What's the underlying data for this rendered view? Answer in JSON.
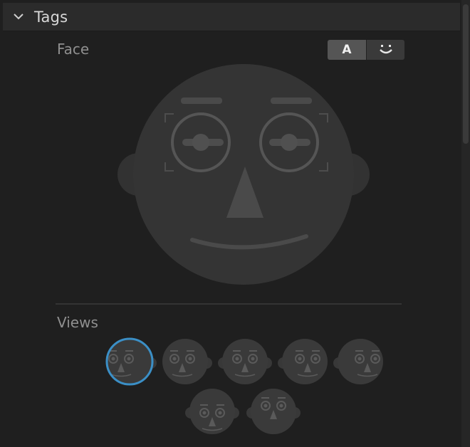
{
  "panel": {
    "title": "Tags"
  },
  "face": {
    "label": "Face",
    "toggle": {
      "options": [
        "A",
        "smile-icon"
      ],
      "selected": "A"
    }
  },
  "views": {
    "label": "Views",
    "selected_index": 0,
    "items": [
      "view-1",
      "view-2",
      "view-3",
      "view-4",
      "view-5",
      "view-6",
      "view-7"
    ]
  },
  "colors": {
    "selection": "#3b8fc6",
    "face": "#333333",
    "feature": "#4a4a4a"
  }
}
